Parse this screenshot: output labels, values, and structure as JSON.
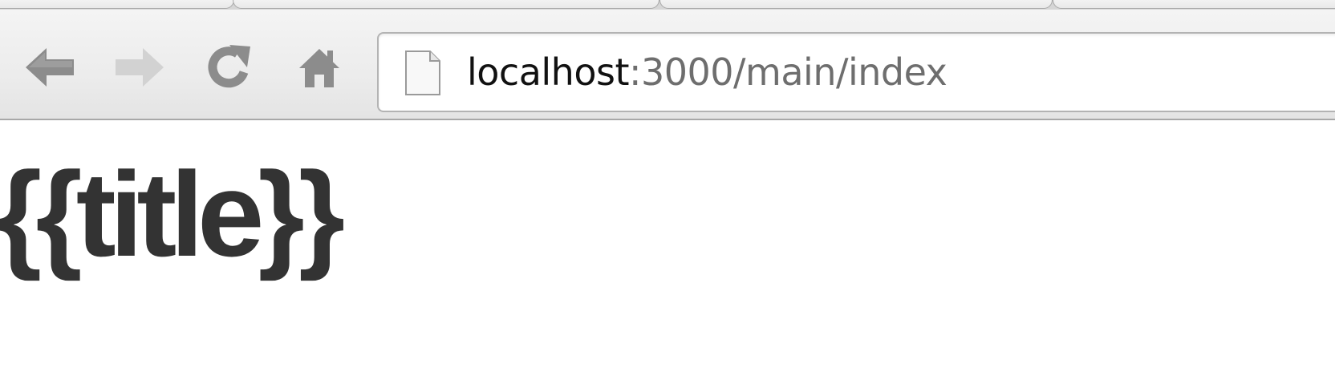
{
  "address_bar": {
    "host": "localhost",
    "path": ":3000/main/index"
  },
  "toolbar": {
    "back_icon": "back-arrow-icon",
    "forward_icon": "forward-arrow-icon",
    "reload_icon": "reload-icon",
    "home_icon": "home-icon"
  },
  "page": {
    "title": "{{title}}"
  },
  "colors": {
    "title_text": "#333333",
    "url_host": "#111111",
    "url_path": "#6e6e6e",
    "toolbar_bg": "#ececec"
  }
}
